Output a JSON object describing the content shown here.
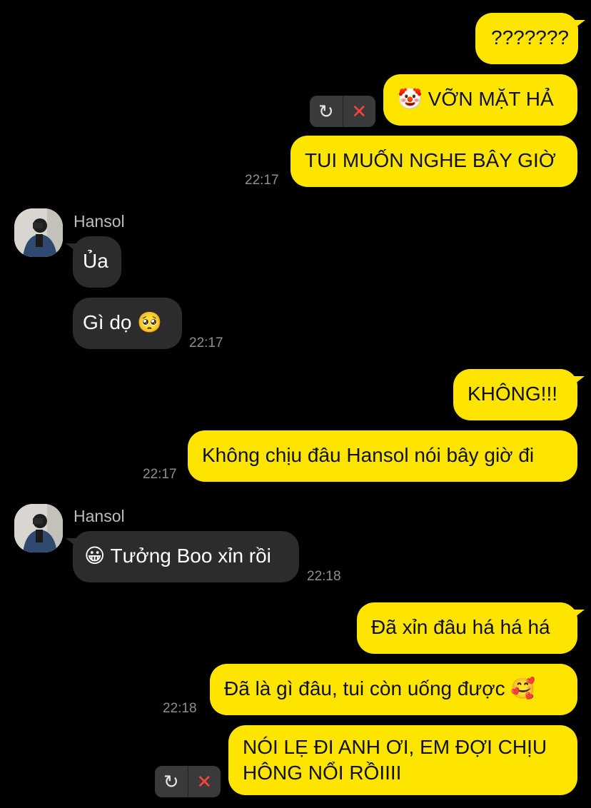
{
  "messages": [
    {
      "text": "???????"
    },
    {
      "emoji": "🤡",
      "text": "VỠN MẶT HẢ",
      "failed": true
    },
    {
      "text": "TUI MUỐN NGHE BÂY GIỜ",
      "time": "22:17"
    },
    {
      "sender": "Hansol",
      "text": "Ủa"
    },
    {
      "text": "Gì dọ",
      "emoji": "🥺",
      "time": "22:17"
    },
    {
      "text": "KHÔNG!!!"
    },
    {
      "text": "Không chịu đâu Hansol nói bây giờ đi",
      "time": "22:17"
    },
    {
      "sender": "Hansol",
      "emoji": "😀",
      "text": "Tưởng Boo xỉn rồi",
      "time": "22:18"
    },
    {
      "text": "Đã xỉn đâu há há há"
    },
    {
      "text": "Đã là gì đâu, tui còn uống được",
      "emoji": "🥰",
      "time": "22:18"
    },
    {
      "line1": "NÓI LẸ ĐI ANH ƠI, EM ĐỢI CHỊU",
      "line2": "HÔNG NỔI RỒIIII",
      "failed": true
    }
  ],
  "icons": {
    "retry": "↻",
    "cancel": "✕"
  },
  "colors": {
    "outgoing": "#FEE500",
    "incoming": "#2C2C2E",
    "background": "#000000",
    "failed_cancel": "#FF453A"
  }
}
